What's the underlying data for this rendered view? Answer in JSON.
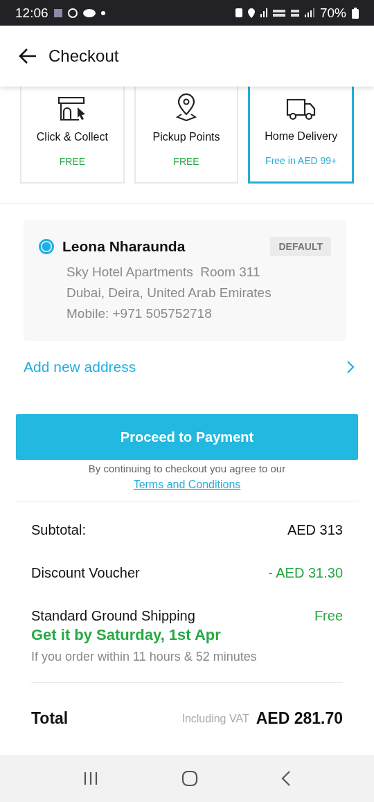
{
  "status_bar": {
    "time": "12:06",
    "battery": "70%"
  },
  "header": {
    "title": "Checkout"
  },
  "delivery_options": [
    {
      "kind": "store",
      "label": "Click & Collect",
      "price": "FREE",
      "selected": false
    },
    {
      "kind": "pin",
      "label": "Pickup Points",
      "price": "FREE",
      "selected": false
    },
    {
      "kind": "truck",
      "label": "Home Delivery",
      "price": "Free in AED 99+",
      "selected": true
    }
  ],
  "address": {
    "selected": true,
    "name": "Leona Nharaunda",
    "badge": "DEFAULT",
    "lines": [
      "Sky Hotel Apartments  Room 311",
      "Dubai, Deira, United Arab Emirates",
      "Mobile: +971 505752718"
    ]
  },
  "add_address": "Add new address",
  "proceed_button": "Proceed to Payment",
  "terms": {
    "text": "By continuing to checkout you agree to our",
    "link": "Terms and Conditions"
  },
  "summary": [
    {
      "kind": "plain",
      "label": "Subtotal:",
      "value": "AED 313"
    },
    {
      "kind": "discount",
      "label": "Discount Voucher",
      "value": "- AED 31.30"
    },
    {
      "kind": "shipping",
      "label": "Standard Ground Shipping",
      "value": "Free",
      "eta": "Get it by Saturday, 1st Apr",
      "note": "If you order within 11 hours & 52 minutes"
    }
  ],
  "total": {
    "label": "Total",
    "note": "Including VAT",
    "value": "AED 281.70"
  }
}
